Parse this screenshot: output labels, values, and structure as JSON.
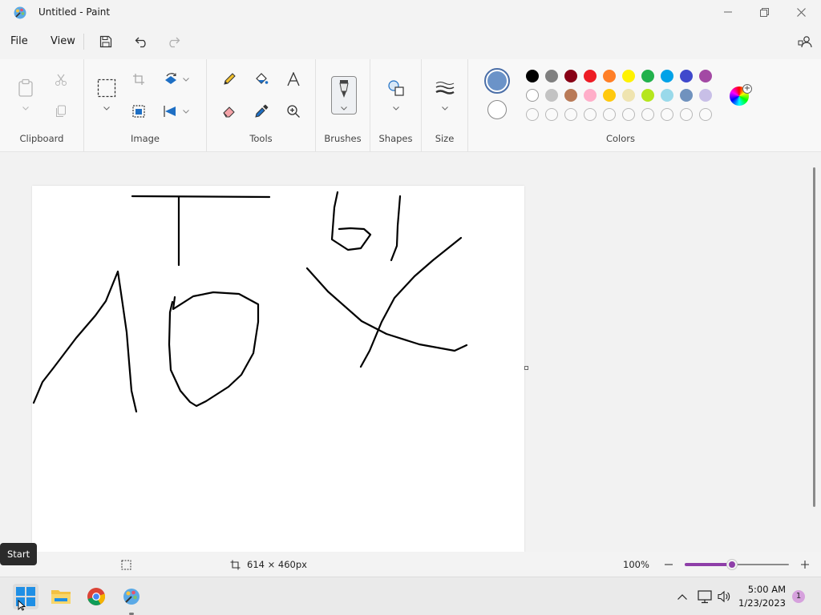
{
  "window": {
    "title": "Untitled - Paint"
  },
  "menu": {
    "file": "File",
    "view": "View"
  },
  "ribbon": {
    "groups": {
      "clipboard": "Clipboard",
      "image": "Image",
      "tools": "Tools",
      "brushes": "Brushes",
      "shapes": "Shapes",
      "size": "Size",
      "colors": "Colors"
    }
  },
  "colors": {
    "primary": "#6b93c8",
    "secondary": "#ffffff",
    "palette_row1": [
      "#000000",
      "#7f7f7f",
      "#880015",
      "#ed1c24",
      "#ff7f27",
      "#fff200",
      "#22b14c",
      "#00a2e8",
      "#3f48cc",
      "#a349a4"
    ],
    "palette_row2": [
      "#ffffff",
      "#c3c3c3",
      "#b97a57",
      "#ffaec9",
      "#ffc90e",
      "#efe4b0",
      "#b5e61d",
      "#99d9ea",
      "#7092be",
      "#c8bfe7"
    ],
    "palette_row3_empty": 10
  },
  "status": {
    "canvas_size": "614 × 460px",
    "zoom": "100%",
    "zoom_fraction": 0.45
  },
  "taskbar": {
    "tooltip": "Start",
    "time": "5:00 AM",
    "date": "1/23/2023",
    "notification_count": "1"
  }
}
